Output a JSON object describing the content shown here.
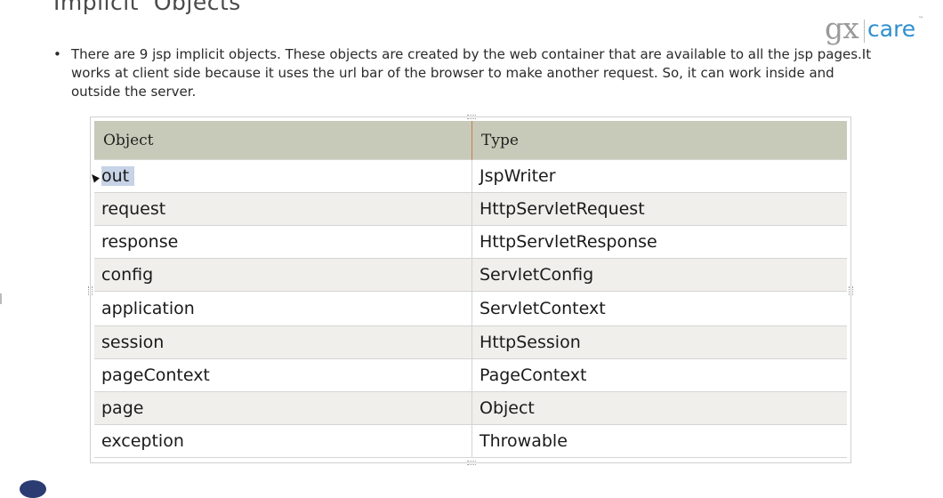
{
  "slide": {
    "title": "Implicit  Objects",
    "bullet_text": "There are 9 jsp implicit objects. These objects are created by the web container that are available to all the jsp pages.It works at client side because it uses the url bar of the browser to make another request. So, it can work inside and outside the server.",
    "bullet_mark": "•"
  },
  "logo": {
    "gx": "gx",
    "care": "care",
    "tm": "™",
    "brand_color": "#2e8fd0"
  },
  "table": {
    "headers": [
      "Object",
      "Type"
    ],
    "header_bg": "#c8cab9",
    "rows": [
      {
        "object": "out",
        "type": "JspWriter"
      },
      {
        "object": "request",
        "type": "HttpServletRequest"
      },
      {
        "object": "response",
        "type": "HttpServletResponse"
      },
      {
        "object": "config",
        "type": "ServletConfig"
      },
      {
        "object": "application",
        "type": "ServletContext"
      },
      {
        "object": "session",
        "type": "HttpSession"
      },
      {
        "object": "pageContext",
        "type": "PageContext"
      },
      {
        "object": "page",
        "type": "Object"
      },
      {
        "object": "exception",
        "type": "Throwable"
      }
    ]
  }
}
